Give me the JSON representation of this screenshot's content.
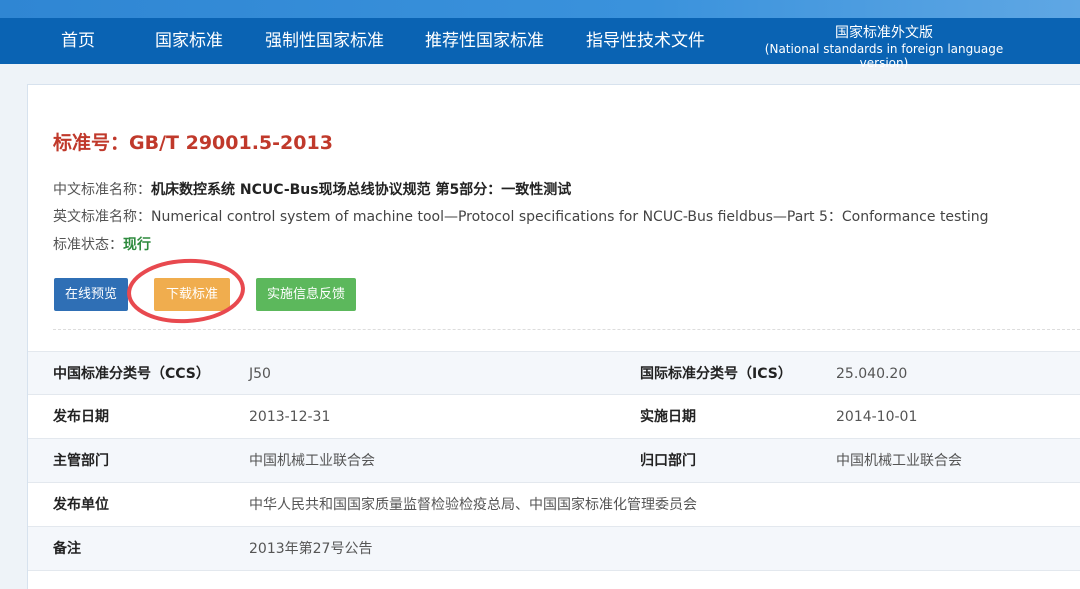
{
  "nav": {
    "items": [
      "首页",
      "国家标准",
      "强制性国家标准",
      "推荐性国家标准",
      "指导性技术文件"
    ],
    "foreign_cn": "国家标准外文版",
    "foreign_en": "(National standards in foreign language version)"
  },
  "standard": {
    "number_label": "标准号：",
    "number": "GB/T 29001.5-2013",
    "cn_name_label": "中文标准名称：",
    "cn_name": "机床数控系统 NCUC-Bus现场总线协议规范 第5部分：一致性测试",
    "en_name_label": "英文标准名称：",
    "en_name": "Numerical control system of machine tool—Protocol specifications for NCUC-Bus fieldbus—Part 5：Conformance testing",
    "status_label": "标准状态：",
    "status": "现行"
  },
  "buttons": {
    "preview": "在线预览",
    "download": "下载标准",
    "feedback": "实施信息反馈"
  },
  "highlight_color": "#e8494f",
  "details": {
    "ccs_label": "中国标准分类号（CCS）",
    "ccs": "J50",
    "ics_label": "国际标准分类号（ICS）",
    "ics": "25.040.20",
    "publish_date_label": "发布日期",
    "publish_date": "2013-12-31",
    "effective_date_label": "实施日期",
    "effective_date": "2014-10-01",
    "dept_label": "主管部门",
    "dept": "中国机械工业联合会",
    "centralized_label": "归口部门",
    "centralized": "中国机械工业联合会",
    "publisher_label": "发布单位",
    "publisher": "中华人民共和国国家质量监督检验检疫总局、中国国家标准化管理委员会",
    "remark_label": "备注",
    "remark": "2013年第27号公告"
  }
}
